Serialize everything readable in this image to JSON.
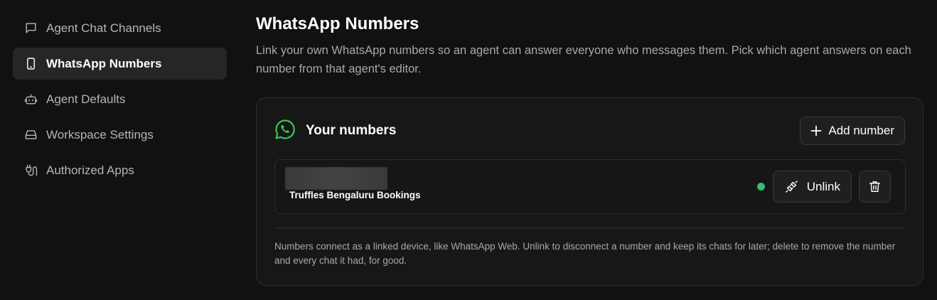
{
  "sidebar": {
    "items": [
      {
        "label": "Agent Chat Channels",
        "icon": "chat-bubble-icon",
        "active": false
      },
      {
        "label": "WhatsApp Numbers",
        "icon": "phone-icon",
        "active": true
      },
      {
        "label": "Agent Defaults",
        "icon": "bot-icon",
        "active": false
      },
      {
        "label": "Workspace Settings",
        "icon": "drive-icon",
        "active": false
      },
      {
        "label": "Authorized Apps",
        "icon": "plug-icon",
        "active": false
      }
    ]
  },
  "header": {
    "title": "WhatsApp Numbers",
    "description": "Link your own WhatsApp numbers so an agent can answer everyone who messages them. Pick which agent answers on each number from that agent's editor."
  },
  "numbers_card": {
    "title": "Your numbers",
    "add_label": "Add number",
    "numbers": [
      {
        "name": "Truffles Bengaluru Bookings",
        "status": "connected",
        "unlink_label": "Unlink"
      }
    ],
    "footnote": "Numbers connect as a linked device, like WhatsApp Web. Unlink to disconnect a number and keep its chats for later; delete to remove the number and every chat it had, for good."
  },
  "colors": {
    "background": "#111111",
    "whatsapp_green": "#34c759",
    "status_connected": "#2fbf71"
  }
}
